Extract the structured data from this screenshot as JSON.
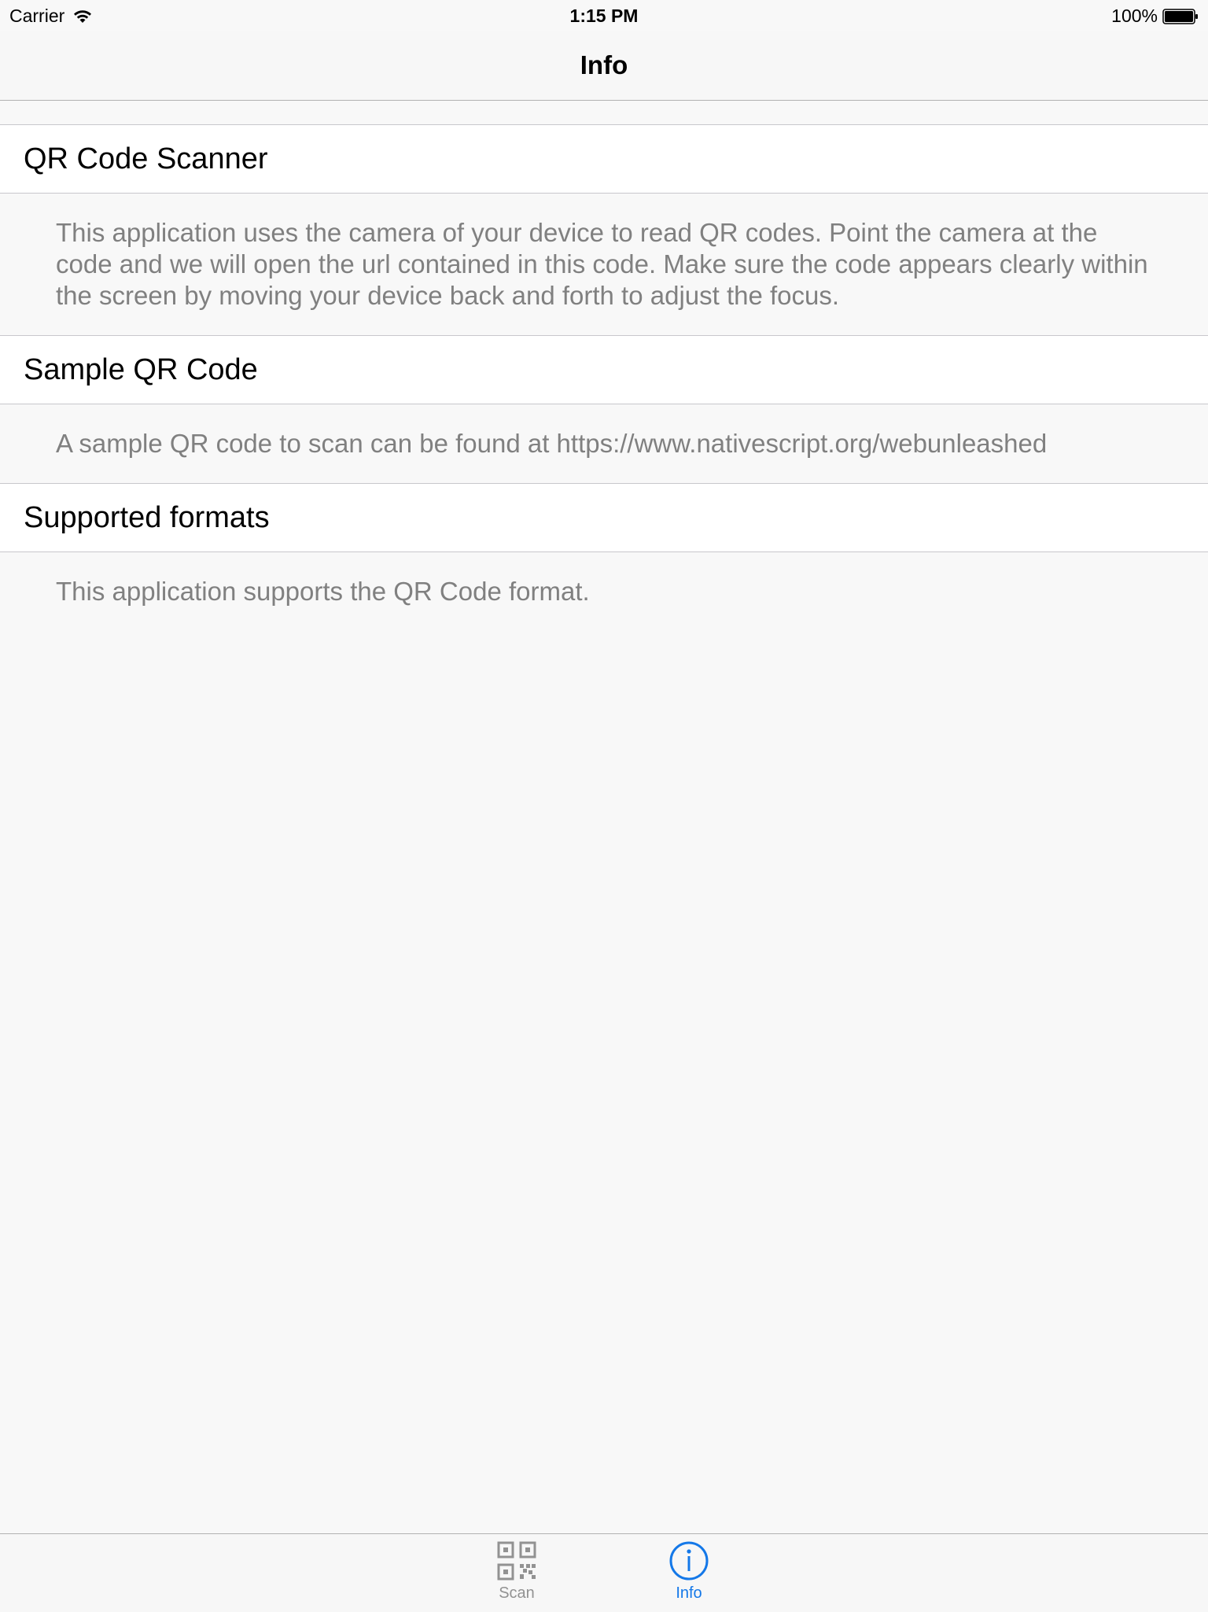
{
  "status_bar": {
    "carrier": "Carrier",
    "time": "1:15 PM",
    "battery": "100%"
  },
  "nav": {
    "title": "Info"
  },
  "sections": [
    {
      "header": "QR Code Scanner",
      "body": "This application uses the camera of your device to read QR codes. Point the camera at the code and we will open the url contained in this code. Make sure the code appears clearly within the screen by moving your device back and forth to adjust the focus."
    },
    {
      "header": "Sample QR Code",
      "body": "A sample QR code to scan can be found at https://www.nativescript.org/webunleashed"
    },
    {
      "header": "Supported formats",
      "body": "This application supports the QR Code format."
    }
  ],
  "tabs": [
    {
      "label": "Scan",
      "icon": "qr-code-icon",
      "selected": false
    },
    {
      "label": "Info",
      "icon": "info-icon",
      "selected": true
    }
  ],
  "colors": {
    "accent": "#1478e8",
    "inactive": "#929292",
    "body_text": "#808080",
    "background": "#f8f8f8"
  }
}
